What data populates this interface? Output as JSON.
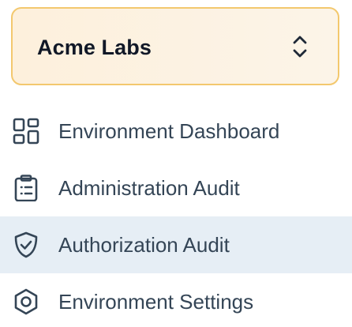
{
  "org_switcher": {
    "name": "Acme Labs",
    "icon": "chevron-up-down-icon"
  },
  "nav": {
    "items": [
      {
        "label": "Environment Dashboard",
        "icon": "grid-icon",
        "active": false
      },
      {
        "label": "Administration Audit",
        "icon": "clipboard-list-icon",
        "active": false
      },
      {
        "label": "Authorization Audit",
        "icon": "shield-check-icon",
        "active": true
      },
      {
        "label": "Environment Settings",
        "icon": "settings-hexagon-icon",
        "active": false
      }
    ]
  },
  "colors": {
    "switcher_border": "#f3c86e",
    "switcher_bg": "#fdf0dc",
    "active_bg": "#e6eef5",
    "nav_text": "#344556"
  }
}
